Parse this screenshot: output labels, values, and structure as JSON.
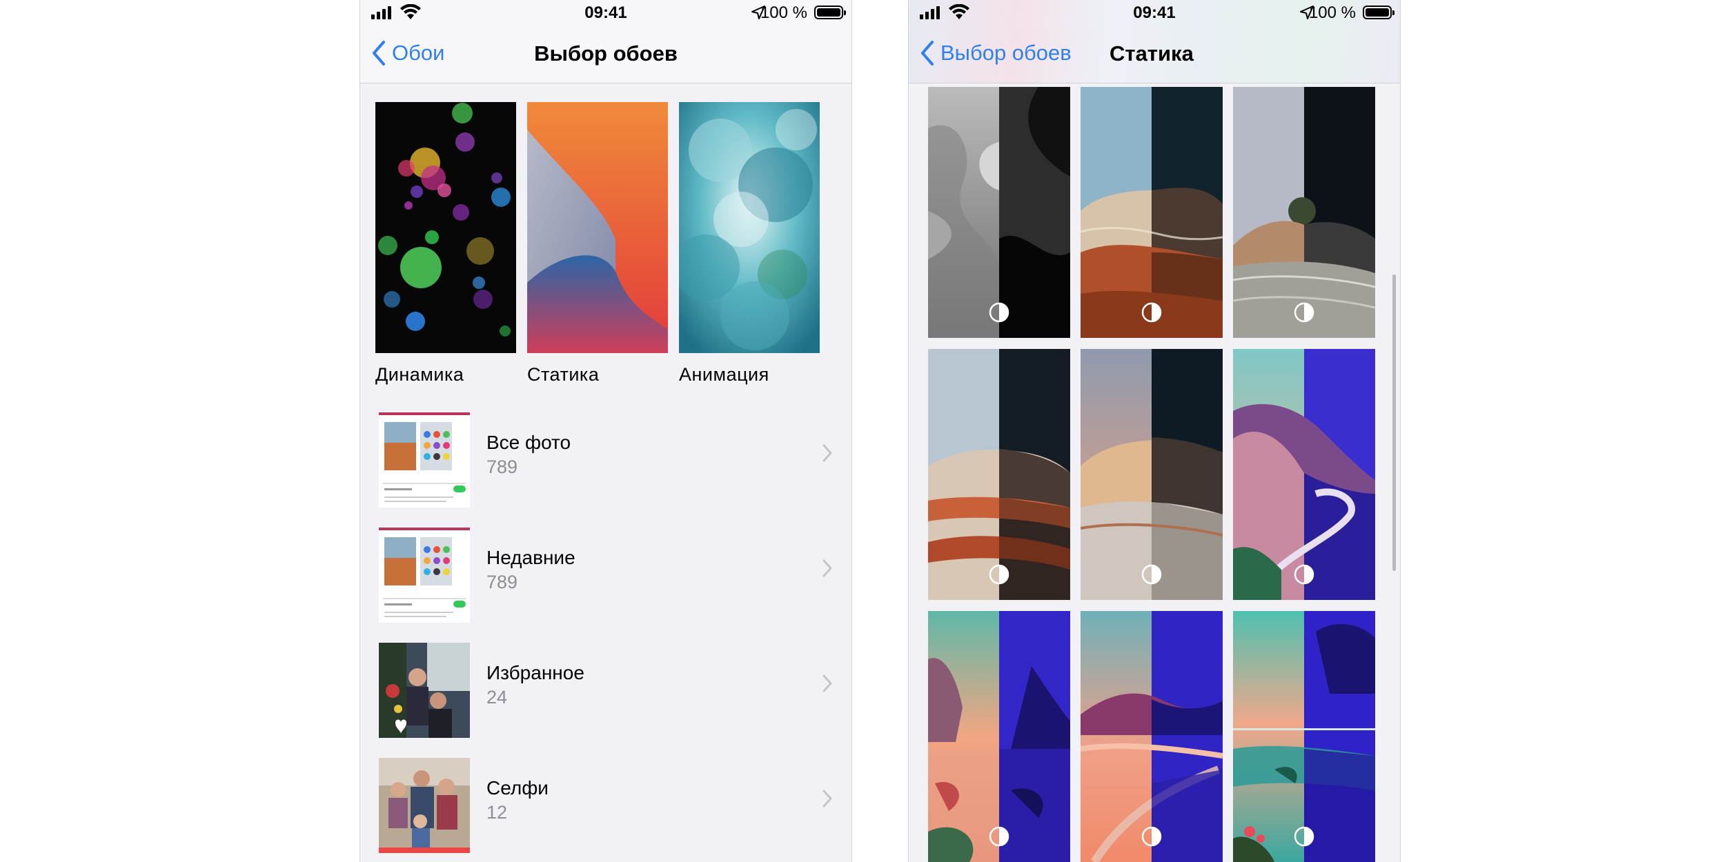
{
  "status_bar": {
    "time": "09:41",
    "battery": "100 %"
  },
  "left": {
    "back_label": "Обои",
    "title": "Выбор обоев",
    "categories": [
      {
        "label": "Динамика"
      },
      {
        "label": "Статика"
      },
      {
        "label": "Анимация"
      }
    ],
    "albums": [
      {
        "name": "Все фото",
        "count": "789"
      },
      {
        "name": "Недавние",
        "count": "789"
      },
      {
        "name": "Избранное",
        "count": "24"
      },
      {
        "name": "Селфи",
        "count": "12"
      }
    ]
  },
  "right": {
    "back_label": "Выбор обоев",
    "title": "Статика",
    "grid_icon": "light-dark-mode-icon"
  },
  "colors": {
    "accent": "#2f7ff0",
    "secondary_text": "#8e8e93",
    "background": "#f2f1f6"
  }
}
